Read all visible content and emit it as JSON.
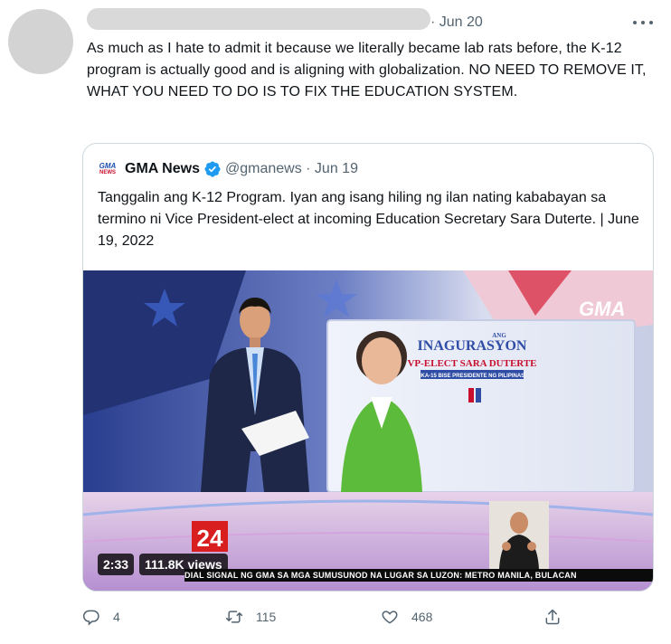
{
  "tweet": {
    "date": "· Jun 20",
    "text": "As much as I hate to admit it because we literally became lab rats before, the K-12 program is actually good and is aligning with globalization. NO NEED TO REMOVE IT, WHAT YOU NEED TO DO IS TO FIX THE EDUCATION SYSTEM."
  },
  "quote": {
    "logo_line1": "GMA",
    "logo_line2": "NEWS",
    "name": "GMA News",
    "handle_date": "@gmanews · Jun 19",
    "text": "Tanggalin ang K-12 Program. Iyan ang isang hiling ng ilan nating kababayan sa termino ni Vice President-elect at incoming Education Secretary Sara Duterte. | June 19, 2022",
    "media": {
      "channel_logo": "GMA",
      "banner_ang": "ANG",
      "banner_title": "INAGURASYON",
      "banner_subtitle": "VP-ELECT SARA DUTERTE",
      "banner_tagline": "IKA-15 BISE PRESIDENTE NG PILIPINAS",
      "logo_24": "24",
      "duration": "2:33",
      "views": "111.8K views",
      "ticker": "DIAL SIGNAL NG GMA SA MGA SUMUSUNOD NA LUGAR SA LUZON: METRO MANILA, BULACAN"
    }
  },
  "actions": {
    "replies": "4",
    "retweets": "115",
    "likes": "468"
  },
  "colors": {
    "text_primary": "#0f1419",
    "text_secondary": "#536471",
    "border": "#cfd9de",
    "verified": "#1d9bf0"
  },
  "icons": [
    "more-icon",
    "verified-icon",
    "reply-icon",
    "retweet-icon",
    "like-icon",
    "share-icon"
  ]
}
